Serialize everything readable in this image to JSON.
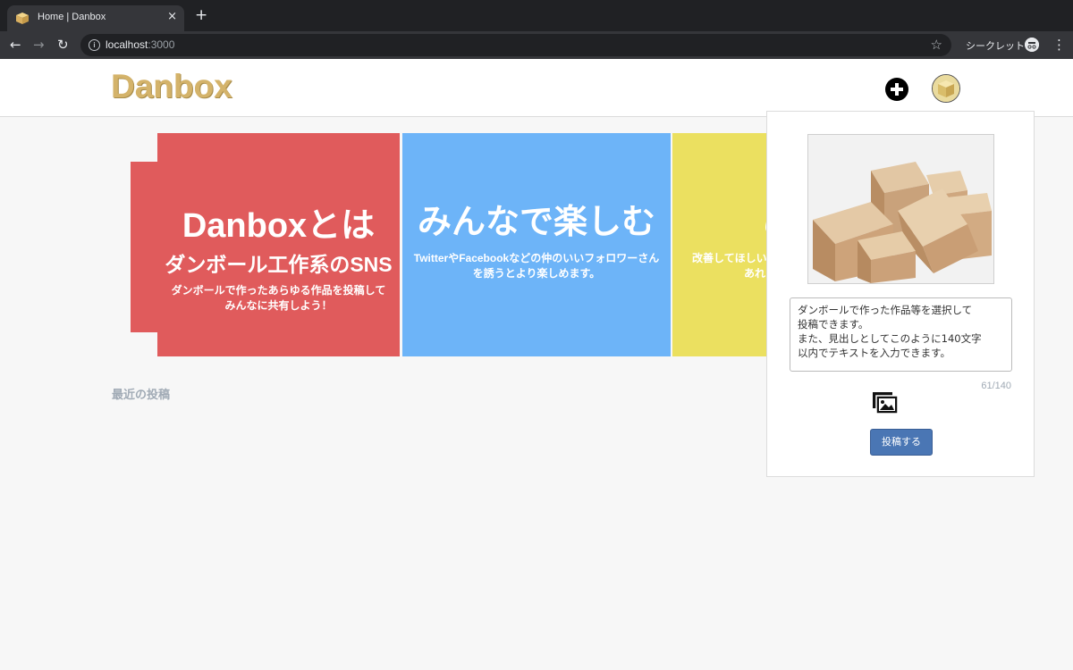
{
  "browser": {
    "tab_title": "Home | Danbox",
    "tab_close": "×",
    "new_tab": "+",
    "url_host": "localhost",
    "url_port": ":3000",
    "incognito_label": "シークレット",
    "icons": [
      "back-icon",
      "forward-icon",
      "reload-icon",
      "info-icon",
      "star-icon",
      "incognito-icon",
      "menu-icon"
    ]
  },
  "header": {
    "logo": "Danbox",
    "brand_color": "#d4b36a"
  },
  "hero": {
    "panels": [
      {
        "title": "Danboxとは",
        "subtitle": "ダンボール工作系のSNS",
        "body_line1": "ダンボールで作ったあらゆる作品を投稿して",
        "body_line2": "みんなに共有しよう！",
        "color": "#e05b5c"
      },
      {
        "title": "みんなで楽しむ",
        "body_line1": "TwitterやFacebookなどの仲のいいフォロワーさん",
        "body_line2": "を誘うとより楽しめます。",
        "color": "#6db4f8"
      },
      {
        "title": "こ",
        "body_line1": "改善してほしい",
        "body_line2": "あれ",
        "color": "#ebe060"
      }
    ]
  },
  "main": {
    "recent_heading": "最近の投稿"
  },
  "post_popup": {
    "text_value": "ダンボールで作った作品等を選択して\n投稿できます。\nまた、見出しとしてこのように140文字\n以内でテキストを入力できます。",
    "char_count": "61/140",
    "submit_label": "投稿する",
    "accent_color": "#4a76b4"
  }
}
